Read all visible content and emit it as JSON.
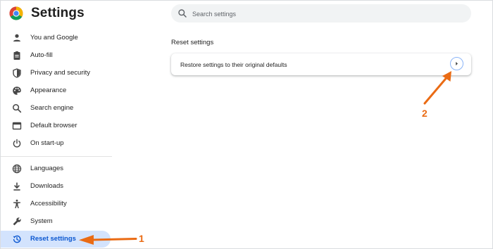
{
  "app": {
    "title": "Settings",
    "logo_icon": "chrome-logo-icon"
  },
  "search": {
    "placeholder": "Search settings",
    "value": ""
  },
  "sidebar": {
    "items": [
      {
        "label": "You and Google",
        "icon": "person-icon"
      },
      {
        "label": "Auto-fill",
        "icon": "clipboard-icon"
      },
      {
        "label": "Privacy and security",
        "icon": "shield-icon"
      },
      {
        "label": "Appearance",
        "icon": "palette-icon"
      },
      {
        "label": "Search engine",
        "icon": "search-icon"
      },
      {
        "label": "Default browser",
        "icon": "browser-window-icon"
      },
      {
        "label": "On start-up",
        "icon": "power-icon"
      },
      {
        "label": "Languages",
        "icon": "globe-icon"
      },
      {
        "label": "Downloads",
        "icon": "download-icon"
      },
      {
        "label": "Accessibility",
        "icon": "accessibility-icon"
      },
      {
        "label": "System",
        "icon": "wrench-icon"
      },
      {
        "label": "Reset settings",
        "icon": "history-icon",
        "active": true
      }
    ]
  },
  "main": {
    "section_title": "Reset settings",
    "row_label": "Restore settings to their original defaults",
    "row_action_icon": "chevron-right-icon"
  },
  "annotations": {
    "step1": "1",
    "step2": "2",
    "color": "#ea6b14"
  },
  "colors": {
    "active_bg": "#d3e3fd",
    "active_text": "#0b57d0",
    "search_bg": "#f1f3f4"
  }
}
